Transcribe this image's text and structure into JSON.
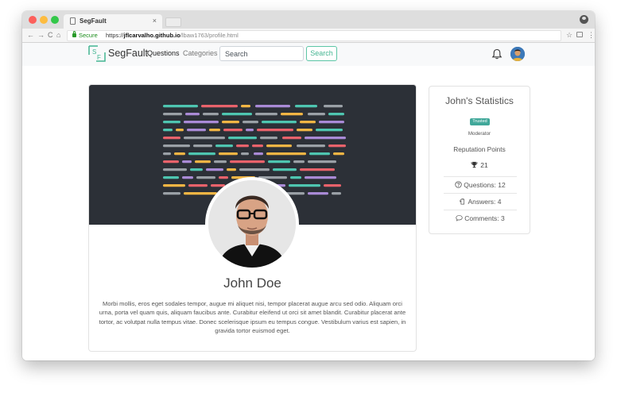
{
  "browser": {
    "tab_title": "SegFault",
    "tab_close": "×",
    "url_secure_label": "Secure",
    "url_scheme": "https://",
    "url_host": "jflcarvalho.github.io",
    "url_path": "/lbaw1763/profile.html",
    "nav_back": "←",
    "nav_forward": "→",
    "nav_reload": "C",
    "nav_home": "⌂",
    "star_icon": "☆",
    "menu_icon": "⋮"
  },
  "navbar": {
    "brand": "SegFault",
    "links": [
      "Questions",
      "Categories"
    ],
    "search_placeholder": "Search",
    "search_button": "Search"
  },
  "profile": {
    "name": "John Doe",
    "bio": "Morbi mollis, eros eget sodales tempor, augue mi aliquet nisi, tempor placerat augue arcu sed odio. Aliquam orci urna, porta vel quam quis, aliquam faucibus ante. Curabitur eleifend ut orci sit amet blandit. Curabitur placerat ante tortor, ac volutpat nulla tempus vitae. Donec scelerisque ipsum eu tempus congue. Vestibulum varius est sapien, in gravida tortor euismod eget."
  },
  "stats": {
    "title": "John's Statistics",
    "badge": "Trusted",
    "role": "Moderator",
    "reputation_label": "Reputation Points",
    "reputation_value": "21",
    "questions": "Questions: 12",
    "answers": "Answers: 4",
    "comments": "Comments: 3"
  },
  "colors": {
    "accent": "#43b591",
    "badge": "#41a89a",
    "cover_bg": "#2c3037",
    "code_palette": [
      "#4ec5b0",
      "#e8626b",
      "#f2b544",
      "#a98ad6",
      "#9aa0a6"
    ]
  }
}
